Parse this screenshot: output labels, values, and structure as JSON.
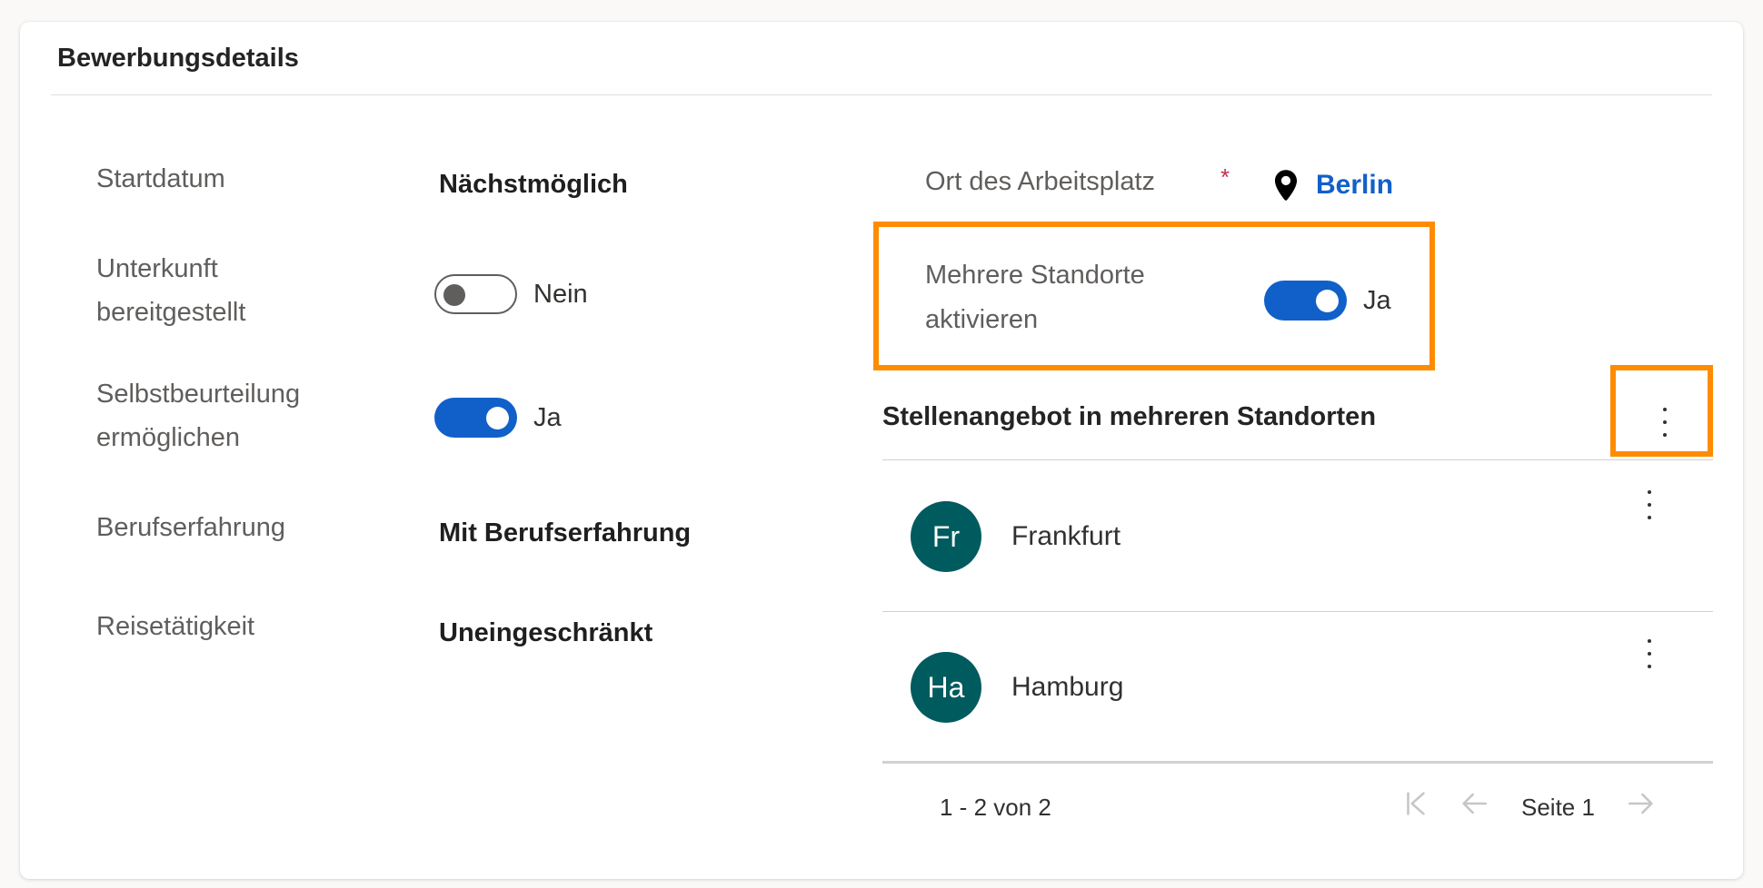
{
  "card": {
    "title": "Bewerbungsdetails"
  },
  "left_fields": {
    "startdatum": {
      "label": "Startdatum",
      "value": "Nächstmöglich"
    },
    "unterkunft": {
      "label_line1": "Unterkunft",
      "label_line2": "bereitgestellt",
      "toggle_on": false,
      "toggle_text": "Nein"
    },
    "selbstbeurteilung": {
      "label_line1": "Selbstbeurteilung",
      "label_line2": "ermöglichen",
      "toggle_on": true,
      "toggle_text": "Ja"
    },
    "berufserfahrung": {
      "label": "Berufserfahrung",
      "value": "Mit Berufserfahrung"
    },
    "reisetaetigkeit": {
      "label": "Reisetätigkeit",
      "value": "Uneingeschränkt"
    }
  },
  "right_fields": {
    "ort": {
      "label": "Ort des Arbeitsplatz",
      "required_mark": "*",
      "value": "Berlin",
      "icon": "map-pin-icon"
    },
    "mehrere_standorte": {
      "label_line1": "Mehrere Standorte",
      "label_line2": "aktivieren",
      "toggle_on": true,
      "toggle_text": "Ja"
    }
  },
  "subgrid": {
    "heading": "Stellenangebot in mehreren Standorten",
    "rows": [
      {
        "initials": "Fr",
        "name": "Frankfurt"
      },
      {
        "initials": "Ha",
        "name": "Hamburg"
      }
    ],
    "pager": {
      "range": "1 - 2 von 2",
      "page_label": "Seite 1"
    }
  },
  "colors": {
    "accent": "#1160c9",
    "highlight": "#ff8c00",
    "avatar": "#005b5f",
    "required": "#c4314b"
  }
}
